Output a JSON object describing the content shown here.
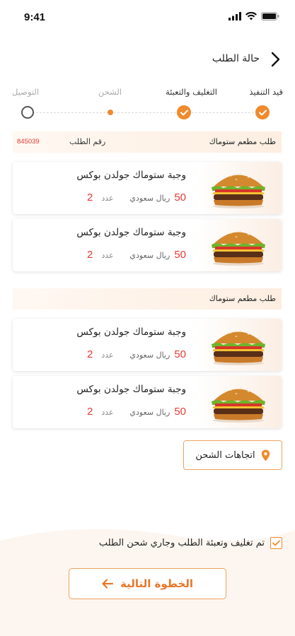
{
  "status_bar": {
    "time": "9:41"
  },
  "header": {
    "title": "حالة الطلب"
  },
  "stepper": {
    "steps": [
      {
        "label": "قيد التنفيذ",
        "state": "done"
      },
      {
        "label": "التغليف والتعبئة",
        "state": "done"
      },
      {
        "label": "الشحن",
        "state": "current"
      },
      {
        "label": "التوصيل",
        "state": "pending"
      }
    ]
  },
  "sections": [
    {
      "title": "طلب مطعم ستوماك",
      "order_number_label": "رقم الطلب",
      "order_number": "845039",
      "items": [
        {
          "name": "وجبة ستوماك جولدن بوكس",
          "price": "50",
          "currency": "ريال سعودي",
          "qty_label": "عدد",
          "qty": "2"
        },
        {
          "name": "وجبة ستوماك جولدن بوكس",
          "price": "50",
          "currency": "ريال سعودي",
          "qty_label": "عدد",
          "qty": "2"
        }
      ]
    },
    {
      "title": "طلب مطعم ستوماك",
      "items": [
        {
          "name": "وجبة ستوماك جولدن بوكس",
          "price": "50",
          "currency": "ريال سعودي",
          "qty_label": "عدد",
          "qty": "2"
        },
        {
          "name": "وجبة ستوماك جولدن بوكس",
          "price": "50",
          "currency": "ريال سعودي",
          "qty_label": "عدد",
          "qty": "2"
        }
      ]
    }
  ],
  "directions_button": {
    "label": "اتجاهات الشحن",
    "icon": "location-pin-icon"
  },
  "confirm": {
    "label": "تم تغليف وتعبئة الطلب وجاري شحن الطلب",
    "checked": true
  },
  "next_button": {
    "label": "الخطوة التالية",
    "icon": "arrow-left-icon"
  },
  "colors": {
    "accent": "#f08a2c",
    "price": "#e53935",
    "band": "#fdeee1"
  }
}
